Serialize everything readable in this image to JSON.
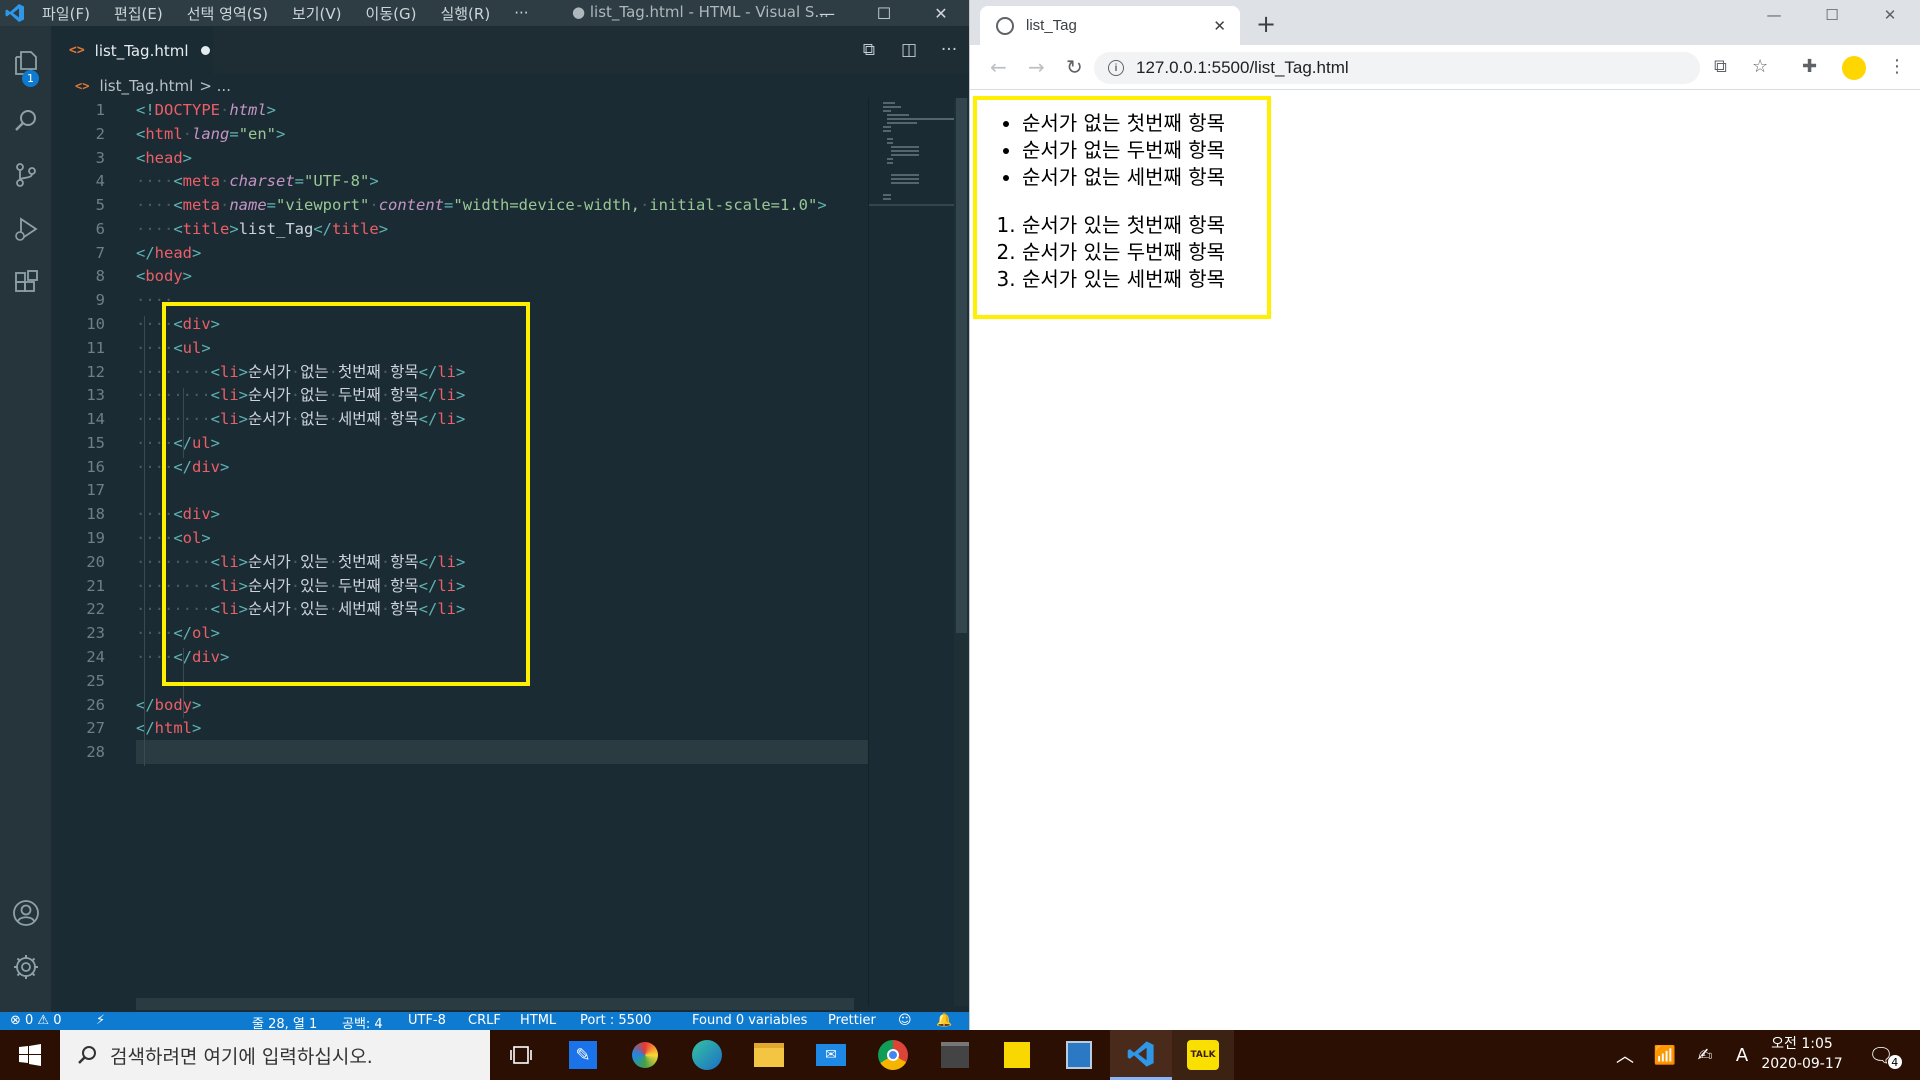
{
  "vscode": {
    "menu": [
      "파일(F)",
      "편집(E)",
      "선택 영역(S)",
      "보기(V)",
      "이동(G)",
      "실행(R)",
      "···"
    ],
    "window_title": "● list_Tag.html - HTML - Visual S...",
    "tab_label": "list_Tag.html",
    "breadcrumb_file": "list_Tag.html",
    "breadcrumb_rest": "> ...",
    "explorer_badge": "1",
    "line_numbers": [
      "1",
      "2",
      "3",
      "4",
      "5",
      "6",
      "7",
      "8",
      "9",
      "10",
      "11",
      "12",
      "13",
      "14",
      "15",
      "16",
      "17",
      "18",
      "19",
      "20",
      "21",
      "22",
      "23",
      "24",
      "25",
      "26",
      "27",
      "28"
    ],
    "status": {
      "problems": "⊗ 0 ⚠ 0",
      "cursor": "줄 28, 열 1",
      "spaces": "공백: 4",
      "encoding": "UTF-8",
      "eol": "CRLF",
      "language": "HTML",
      "port": "Port : 5500",
      "variables": "Found 0 variables",
      "formatter": "Prettier"
    }
  },
  "browser": {
    "tab_title": "list_Tag",
    "url": "127.0.0.1:5500/list_Tag.html",
    "profile_color": "#ffd600",
    "unordered_items": [
      "순서가 없는 첫번째 항목",
      "순서가 없는 두번째 항목",
      "순서가 없는 세번째 항목"
    ],
    "ordered_items": [
      "순서가 있는 첫번째 항목",
      "순서가 있는 두번째 항목",
      "순서가 있는 세번째 항목"
    ]
  },
  "taskbar": {
    "search_placeholder": "검색하려면 여기에 입력하십시오.",
    "clock_time": "오전 1:05",
    "clock_date": "2020-09-17",
    "ime": "A",
    "notification_count": "4"
  },
  "colors": {
    "highlight": "#ffef00",
    "statusbar": "#0e7bd0",
    "editor_bg": "#1b2b34"
  }
}
